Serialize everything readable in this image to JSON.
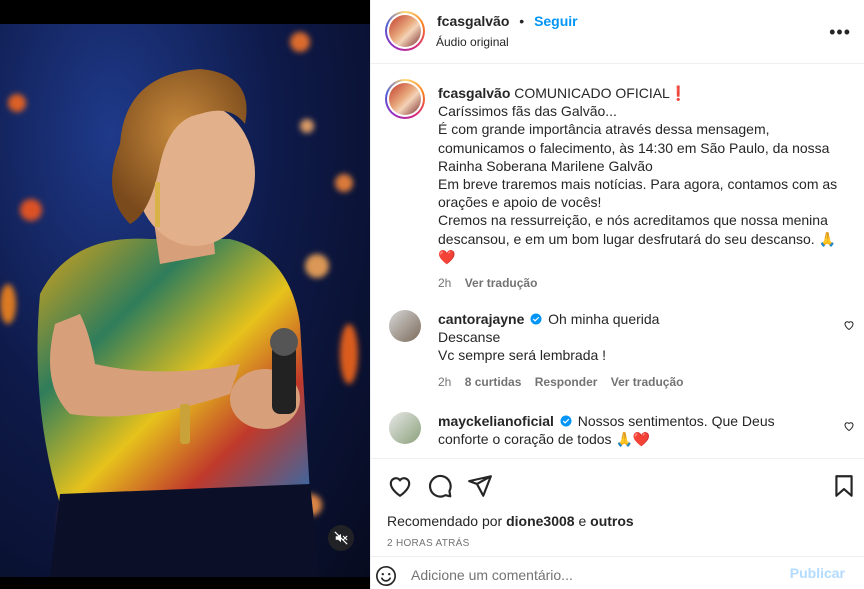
{
  "post": {
    "username": "fcasgalvão",
    "follow_label": "Seguir",
    "audio": "Áudio original",
    "more_label": "•••",
    "caption": {
      "username": "fcasgalvão",
      "line1": "COMUNICADO OFICIAL❗",
      "line2": "Caríssimos fãs das Galvão...",
      "line3": "É com grande importância através dessa mensagem, comunicamos o falecimento, às 14:30 em São Paulo, da nossa Rainha Soberana Marilene Galvão",
      "line4": "Em breve traremos mais notícias. Para agora, contamos com as orações e apoio de vocês!",
      "line5": "Cremos na ressurreição, e nós acreditamos que nossa menina descansou, e em um bom lugar desfrutará do seu descanso. 🙏",
      "line6": "❤️",
      "time": "2h",
      "translate": "Ver tradução"
    },
    "comments": [
      {
        "username": "cantorajayne",
        "verified": true,
        "line1": "Oh minha querida",
        "line2": "Descanse",
        "line3": "Vc sempre será lembrada !",
        "time": "2h",
        "likes": "8 curtidas",
        "reply": "Responder",
        "translate": "Ver tradução"
      },
      {
        "username": "mayckelianoficial",
        "verified": true,
        "text": "Nossos sentimentos. Que Deus conforte o coração de todos 🙏❤️"
      }
    ],
    "liked_prefix": "Recomendado por ",
    "liked_user": "dione3008",
    "liked_and": " e ",
    "liked_others": "outros",
    "timestamp": "2 HORAS ATRÁS",
    "comment_placeholder": "Adicione um comentário...",
    "publish_label": "Publicar"
  },
  "colors": {
    "link_blue": "#0095f6",
    "verified_blue": "#0095f6",
    "muted_gray": "#737373",
    "heart_red": "#ed4956",
    "publish_disabled": "#b3dbff"
  },
  "icons": [
    "mute-icon",
    "more-icon",
    "verified-icon",
    "heart-icon",
    "comment-icon",
    "share-icon",
    "bookmark-icon",
    "emoji-icon"
  ]
}
